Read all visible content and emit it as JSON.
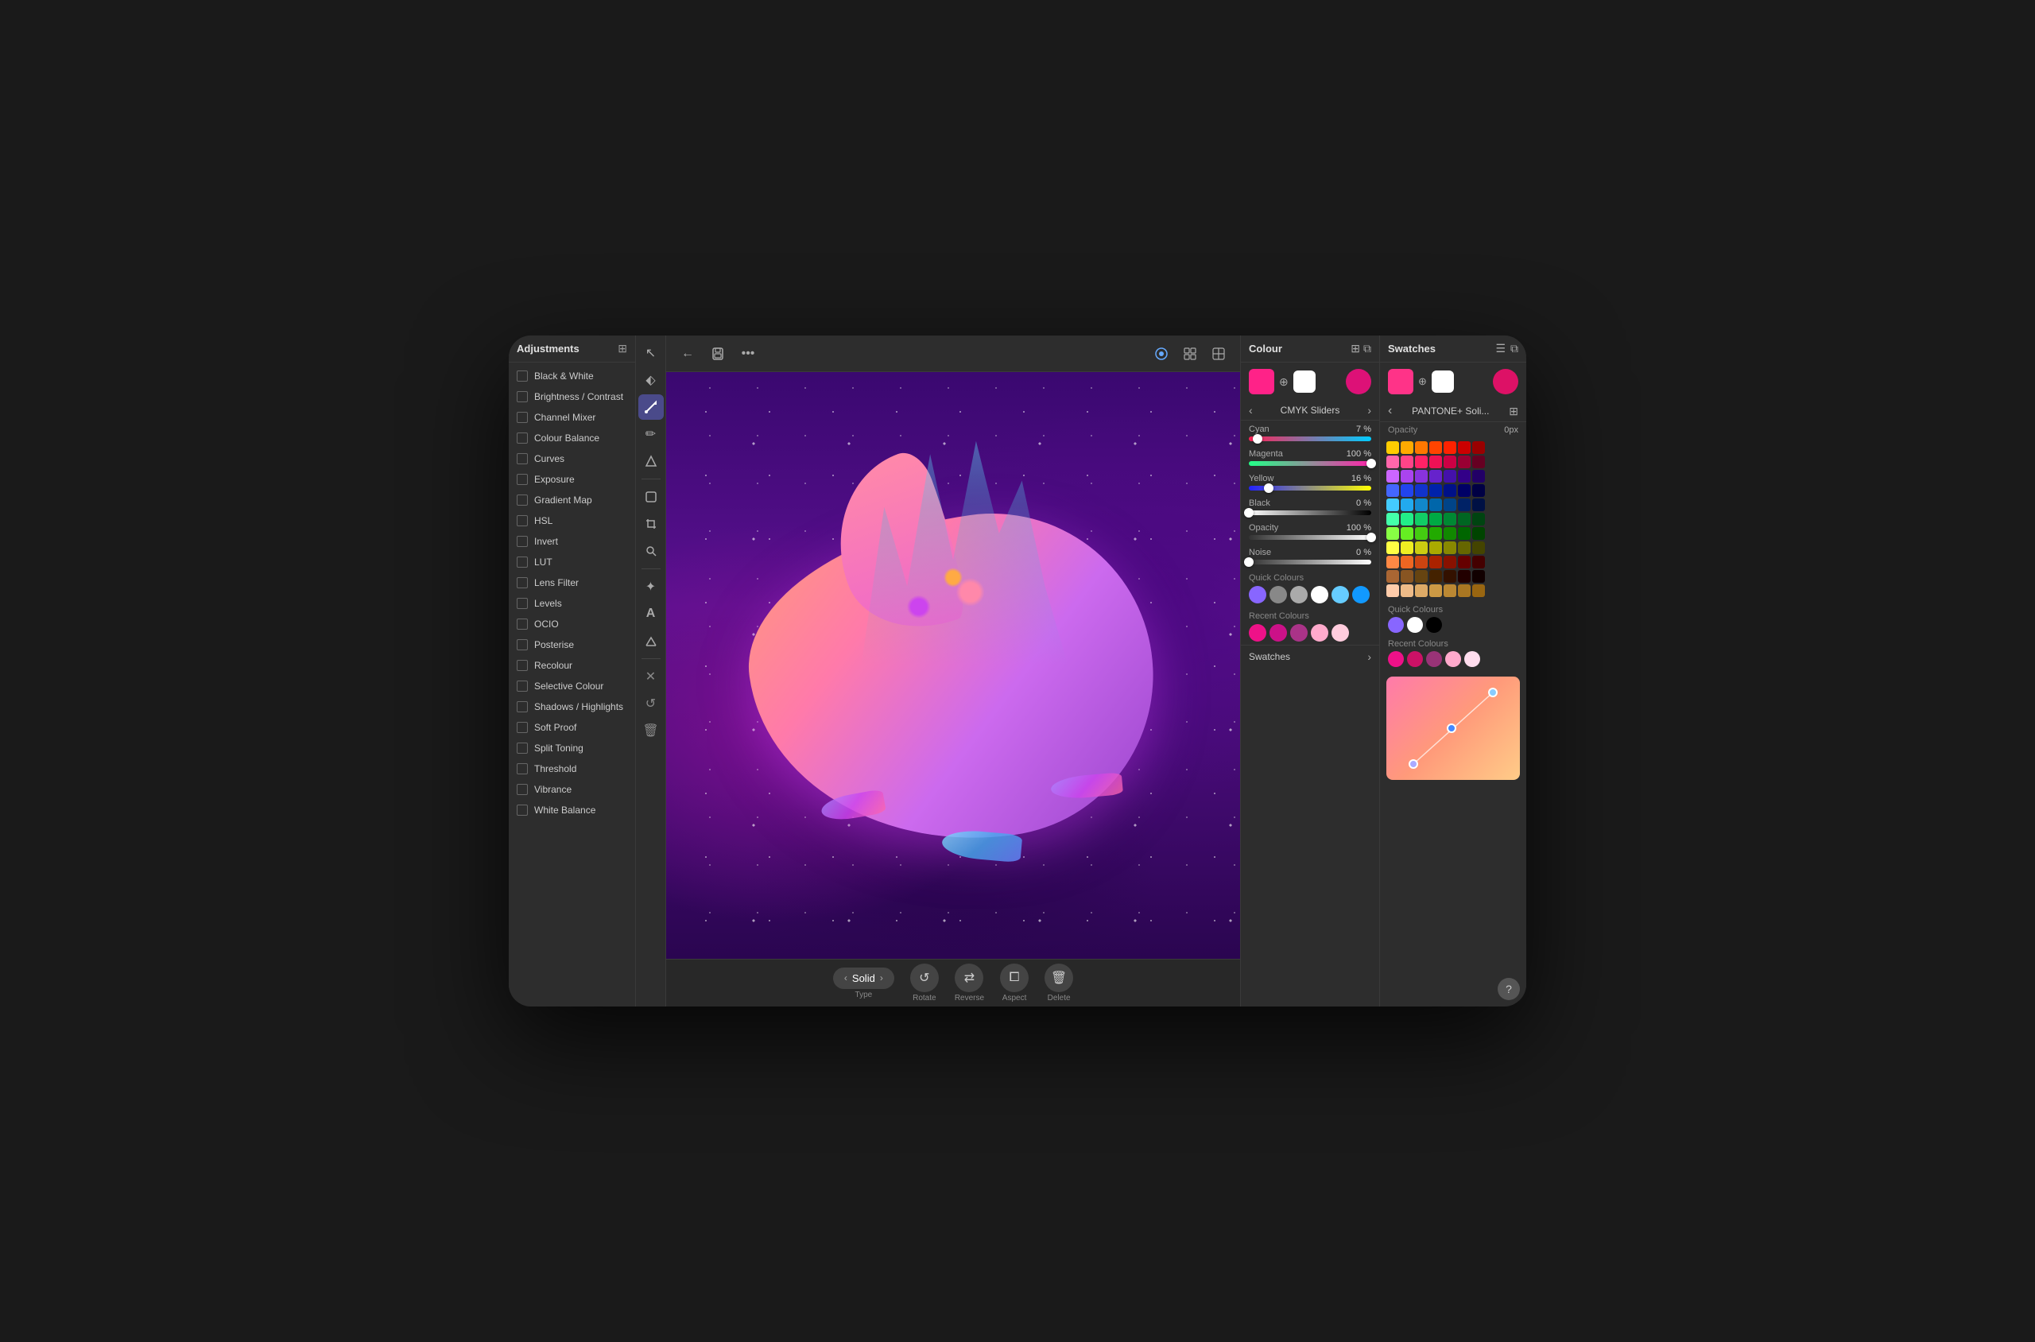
{
  "adjustments": {
    "title": "Adjustments",
    "icon": "⊞",
    "items": [
      {
        "label": "Black & White",
        "checked": false
      },
      {
        "label": "Brightness / Contrast",
        "checked": false
      },
      {
        "label": "Channel Mixer",
        "checked": false
      },
      {
        "label": "Colour Balance",
        "checked": false
      },
      {
        "label": "Curves",
        "checked": false
      },
      {
        "label": "Exposure",
        "checked": false
      },
      {
        "label": "Gradient Map",
        "checked": false
      },
      {
        "label": "HSL",
        "checked": false
      },
      {
        "label": "Invert",
        "checked": false
      },
      {
        "label": "LUT",
        "checked": false
      },
      {
        "label": "Lens Filter",
        "checked": false
      },
      {
        "label": "Levels",
        "checked": false
      },
      {
        "label": "OCIO",
        "checked": false
      },
      {
        "label": "Posterise",
        "checked": false
      },
      {
        "label": "Recolour",
        "checked": false
      },
      {
        "label": "Selective Colour",
        "checked": false
      },
      {
        "label": "Shadows / Highlights",
        "checked": false
      },
      {
        "label": "Soft Proof",
        "checked": false
      },
      {
        "label": "Split Toning",
        "checked": false
      },
      {
        "label": "Threshold",
        "checked": false
      },
      {
        "label": "Vibrance",
        "checked": false
      },
      {
        "label": "White Balance",
        "checked": false
      }
    ]
  },
  "toolbar": {
    "tools": [
      {
        "icon": "↖",
        "label": "select",
        "active": false
      },
      {
        "icon": "↙",
        "label": "node-tool",
        "active": false
      },
      {
        "icon": "➤",
        "label": "brush",
        "active": true
      },
      {
        "icon": "✏",
        "label": "pencil",
        "active": false
      },
      {
        "icon": "◻",
        "label": "shape",
        "active": false
      },
      {
        "icon": "⊕",
        "label": "crop",
        "active": false
      },
      {
        "icon": "🔍",
        "label": "zoom",
        "active": false
      },
      {
        "icon": "✦",
        "label": "effects",
        "active": false
      },
      {
        "icon": "A",
        "label": "text",
        "active": false
      },
      {
        "icon": "⊘",
        "label": "erase",
        "active": false
      },
      {
        "icon": "✖",
        "label": "close",
        "active": false
      },
      {
        "icon": "↺",
        "label": "undo",
        "active": false
      },
      {
        "icon": "🗑",
        "label": "delete",
        "active": false
      }
    ]
  },
  "topbar": {
    "back_btn": "←",
    "save_btn": "💾",
    "more_btn": "•••",
    "btn1": "◉",
    "btn2": "⊞",
    "btn3": "⊟"
  },
  "bottombar": {
    "type_label": "Type",
    "solid_label": "Solid",
    "rotate_label": "Rotate",
    "reverse_label": "Reverse",
    "aspect_label": "Aspect",
    "delete_label": "Delete"
  },
  "colour_panel": {
    "title": "Colour",
    "main_swatch": "#ff2288",
    "white_swatch": "#ffffff",
    "fg_swatch": "#dd1177",
    "cmyk_title": "CMYK Sliders",
    "sliders": [
      {
        "name": "Cyan",
        "value": "7 %",
        "pct": 7,
        "color_start": "#ff2255",
        "color_end": "#00ccff"
      },
      {
        "name": "Magenta",
        "value": "100 %",
        "pct": 100,
        "color_start": "#22ff88",
        "color_end": "#ff22aa"
      },
      {
        "name": "Yellow",
        "value": "16 %",
        "pct": 16,
        "color_start": "#2222ff",
        "color_end": "#ffff00"
      },
      {
        "name": "Black",
        "value": "0 %",
        "pct": 0,
        "color_start": "#ffffff",
        "color_end": "#000000"
      }
    ],
    "opacity_label": "Opacity",
    "opacity_value": "100 %",
    "noise_label": "Noise",
    "noise_value": "0 %",
    "quick_colours_label": "Quick Colours",
    "quick_swatches": [
      "#8866ff",
      "#888888",
      "#aaaaaa",
      "#ffffff",
      "#66ccff",
      "#1199ff"
    ],
    "recent_colours_label": "Recent Colours",
    "recent_swatches": [
      "#ee1188",
      "#cc1188",
      "#aa3388",
      "#ffaacc",
      "#ffccdd"
    ],
    "swatches_nav_label": "Swatches"
  },
  "swatches_panel": {
    "title": "Swatches",
    "pantone_title": "PANTONE+ Soli...",
    "main_swatch": "#ff3388",
    "white_swatch": "#ffffff",
    "fg_swatch": "#dd1166",
    "opacity_value": "0px",
    "grid_rows": [
      [
        "#ffcc00",
        "#ffaa00",
        "#ff7700",
        "#ff4400",
        "#ff2200",
        "#cc0000",
        "#990000"
      ],
      [
        "#ff66aa",
        "#ff4488",
        "#ff2266",
        "#ee1155",
        "#cc0044",
        "#990033",
        "#660022"
      ],
      [
        "#cc66ff",
        "#aa44ee",
        "#8833dd",
        "#6622cc",
        "#4411aa",
        "#330088",
        "#220066"
      ],
      [
        "#4466ff",
        "#2244ee",
        "#1133cc",
        "#0022aa",
        "#001188",
        "#000066",
        "#000044"
      ],
      [
        "#44ccff",
        "#22aaee",
        "#1188cc",
        "#0066aa",
        "#004488",
        "#002266",
        "#001144"
      ],
      [
        "#44ffaa",
        "#22ee88",
        "#11cc66",
        "#00aa44",
        "#008833",
        "#006622",
        "#004411"
      ],
      [
        "#88ff44",
        "#66ee22",
        "#44cc11",
        "#22aa00",
        "#118800",
        "#006600",
        "#004400"
      ],
      [
        "#ffff44",
        "#eeee22",
        "#cccc11",
        "#aaaa00",
        "#888800",
        "#666600",
        "#444400"
      ],
      [
        "#ff8844",
        "#ee6622",
        "#cc4411",
        "#aa2200",
        "#881100",
        "#660000",
        "#440000"
      ],
      [
        "#aa6633",
        "#885522",
        "#664411",
        "#442200",
        "#331100",
        "#220000",
        "#110000"
      ],
      [
        "#ffccaa",
        "#eebb88",
        "#ddaa66",
        "#cc9944",
        "#bb8833",
        "#aa7722",
        "#996611"
      ]
    ],
    "quick_colours_label": "Quick Colours",
    "quick_swatches": [
      "#8866ff",
      "#ffffff",
      "#000000"
    ],
    "recent_colours_label": "Recent Colours",
    "recent_swatches": [
      "#ee1188",
      "#cc1166",
      "#993377",
      "#ffaacc",
      "#ffddee"
    ]
  },
  "help": "?"
}
